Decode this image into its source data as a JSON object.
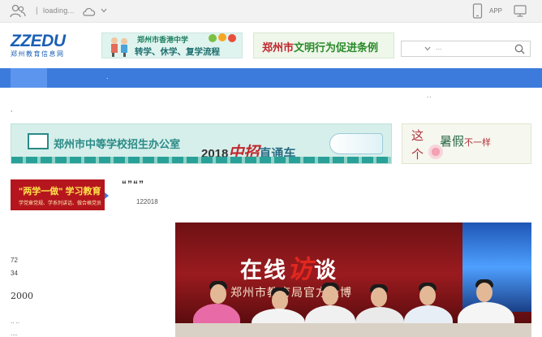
{
  "topbar": {
    "separator": "|",
    "loading_text": "loading...",
    "app_label": "APP"
  },
  "header": {
    "logo_brand": "ZZEDU",
    "logo_sub": "郑州教育信息网",
    "banner1_line1": "郑州市香港中学",
    "banner1_line2": "转学、休学、复学流程",
    "banner2_text_red": "郑州市",
    "banner2_text": "文明行为促进条例",
    "search_dots": "..."
  },
  "nav": {
    "item": "."
  },
  "breadcrumb_right": "..",
  "breadcrumb_left": ",",
  "ads": {
    "big_office": "郑州市中等学校招生办公室",
    "big_year": "2018",
    "big_zhongzhao": "中招",
    "big_tail": "直通车",
    "side_zhe": "这",
    "side_ge": "个",
    "side_slogan": "暑假",
    "side_slogan_small": "不一样",
    "left_line1": "\"两学一做\" 学习教育",
    "left_line2": "学党章党规、学系列讲话、做合格党员"
  },
  "article": {
    "title": "“”“”",
    "meta": "122018"
  },
  "photo": {
    "headline_a": "在线",
    "headline_red": "访",
    "headline_b": "谈",
    "caption": "郑州市教育局官方微博"
  },
  "sidebar_text": {
    "num72": "72",
    "num34": "34",
    "num2000": "2000",
    "dots1": ".. ..",
    "dots2": "...."
  }
}
